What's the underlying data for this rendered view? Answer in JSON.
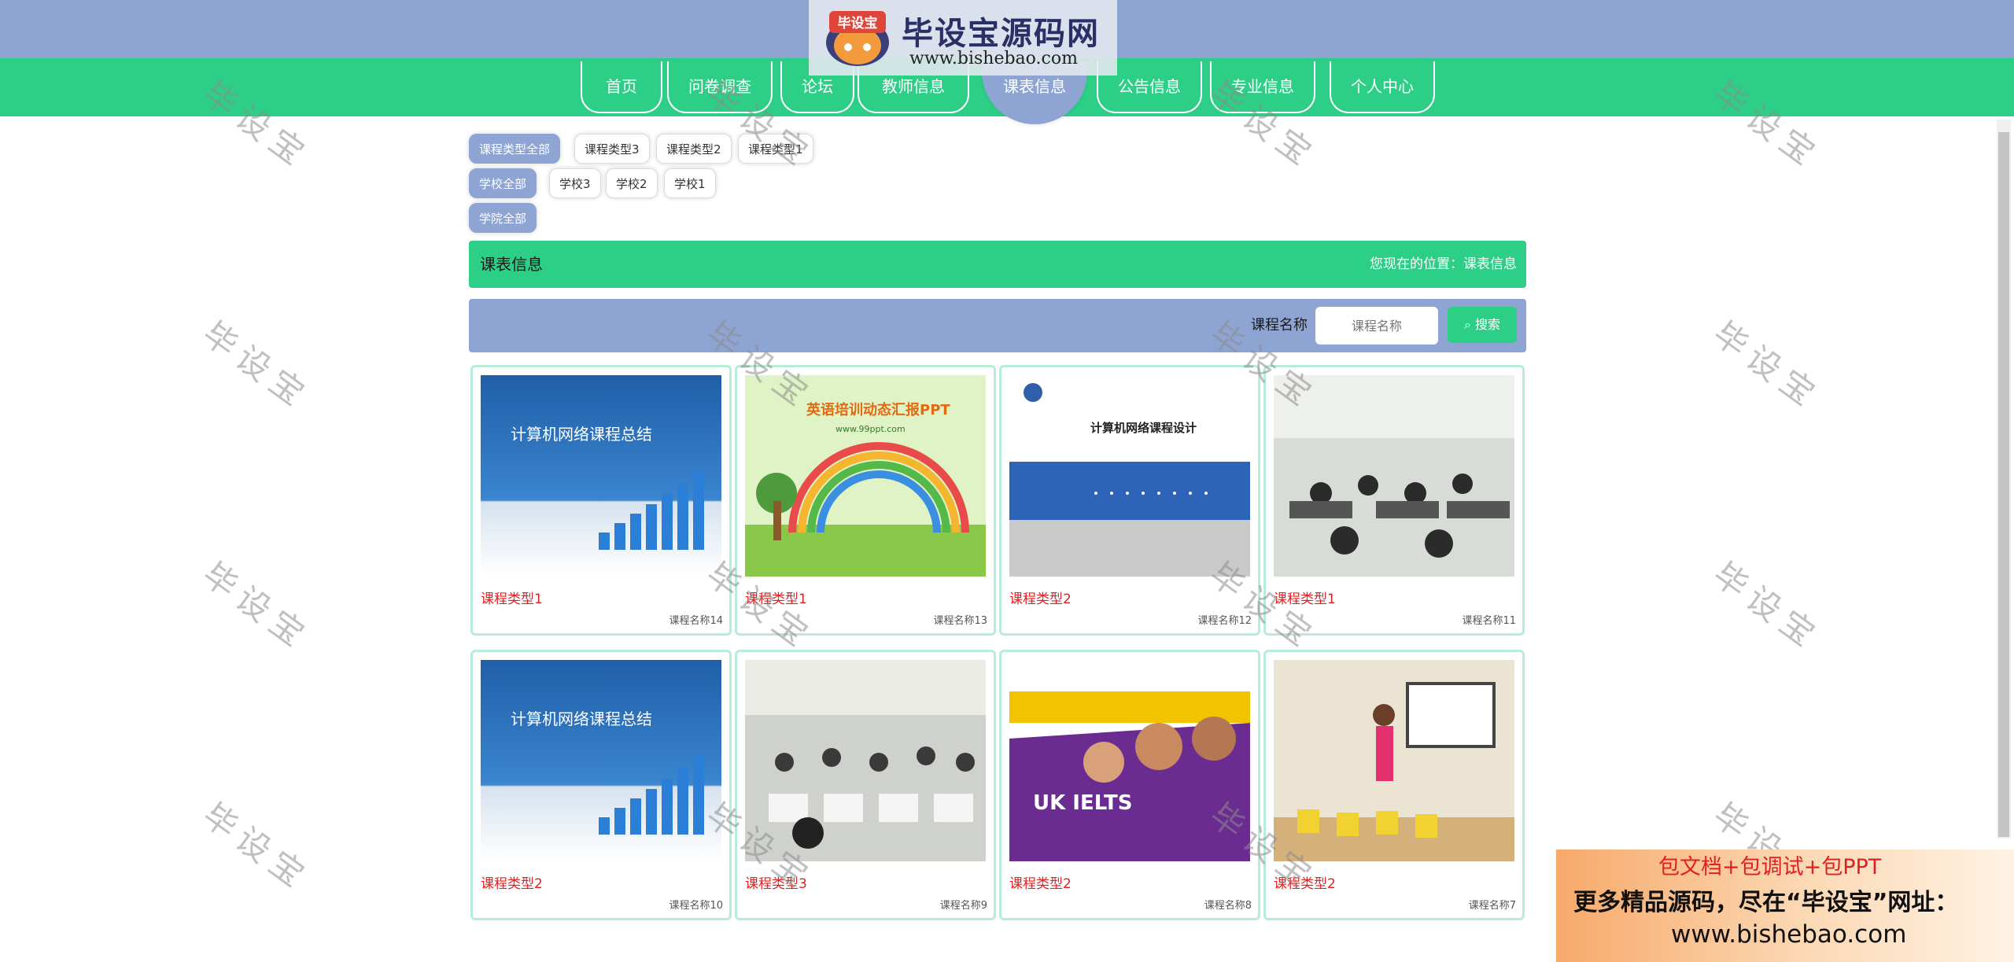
{
  "logo": {
    "title": "毕设宝源码网",
    "url": "www.bishebao.com",
    "badge": "毕设宝"
  },
  "nav": {
    "items": [
      "首页",
      "问卷调查",
      "论坛",
      "教师信息",
      "课表信息",
      "公告信息",
      "专业信息",
      "个人中心"
    ],
    "active": "课表信息"
  },
  "filters": {
    "course_type": [
      "课程类型全部",
      "课程类型3",
      "课程类型2",
      "课程类型1"
    ],
    "school": [
      "学校全部",
      "学校3",
      "学校2",
      "学校1"
    ],
    "college": [
      "学院全部"
    ]
  },
  "section": {
    "title": "课表信息",
    "location": "您现在的位置：课表信息"
  },
  "search": {
    "label": "课程名称",
    "placeholder": "课程名称",
    "button": "搜索"
  },
  "cards": [
    {
      "type": "课程类型1",
      "name": "课程名称14",
      "image_text": "计算机网络课程总结"
    },
    {
      "type": "课程类型1",
      "name": "课程名称13",
      "image_text": "英语培训动态汇报PPT",
      "image_sub": "www.99ppt.com"
    },
    {
      "type": "课程类型2",
      "name": "课程名称12",
      "image_text": "计算机网络课程设计"
    },
    {
      "type": "课程类型1",
      "name": "课程名称11",
      "image_text": ""
    },
    {
      "type": "课程类型2",
      "name": "课程名称10",
      "image_text": "计算机网络课程总结"
    },
    {
      "type": "课程类型3",
      "name": "课程名称9",
      "image_text": ""
    },
    {
      "type": "课程类型2",
      "name": "课程名称8",
      "image_text": "UK IELTS"
    },
    {
      "type": "课程类型2",
      "name": "课程名称7",
      "image_text": ""
    }
  ],
  "watermark": "毕设宝",
  "ad": {
    "line1": "包文档+包调试+包PPT",
    "line2": "更多精品源码，尽在“毕设宝”网址：",
    "line3": "www.bishebao.com"
  },
  "colors": {
    "header_blue": "#8ea4d2",
    "nav_green": "#2dcf86",
    "type_red": "#e02020"
  }
}
